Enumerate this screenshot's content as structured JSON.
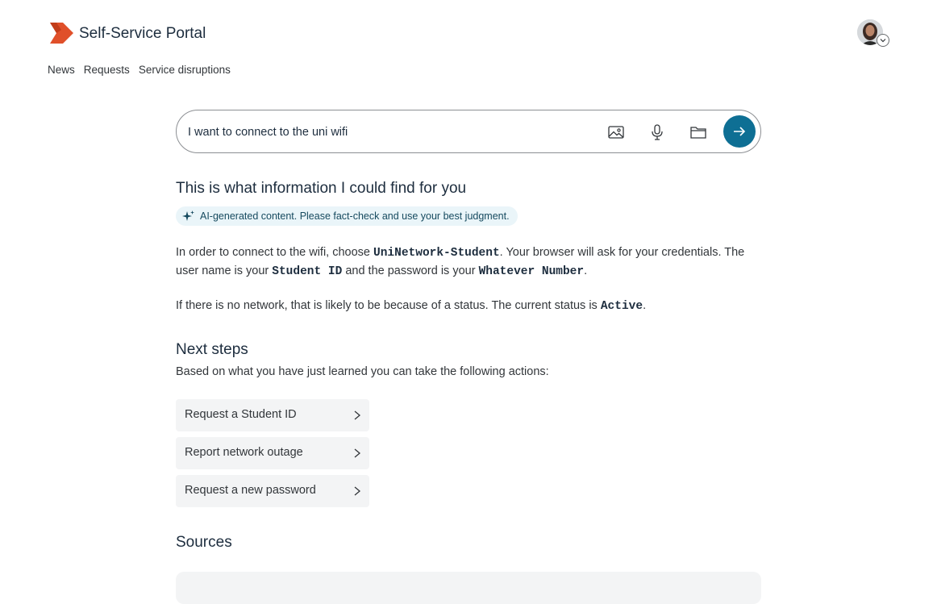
{
  "header": {
    "app_title": "Self-Service Portal",
    "logo_icon": "portal-logo-icon",
    "brand_color": "#e0502a"
  },
  "nav": {
    "items": [
      {
        "label": "News"
      },
      {
        "label": "Requests"
      },
      {
        "label": "Service disruptions"
      }
    ]
  },
  "search": {
    "value": "I want to connect to the uni wifi",
    "placeholder": "",
    "tools": [
      "image-icon",
      "microphone-icon",
      "folder-icon"
    ],
    "send_icon": "arrow-right-icon",
    "accent": "#0e6f94"
  },
  "result": {
    "title": "This is what information I could find for you",
    "ai_notice": "AI-generated content. Please fact-check and use your best judgment.",
    "paragraph1": {
      "t1": "In order to connect to the wifi, choose ",
      "network": "UniNetwork-Student",
      "t2": ". Your browser will ask for your credentials. The user name is your ",
      "user": "Student ID",
      "t3": " and the password is your ",
      "password": "Whatever Number",
      "t4": "."
    },
    "paragraph2": {
      "t1": "If there is no network, that is likely to be because of a status. The current status is ",
      "status": "Active",
      "t2": "."
    }
  },
  "next_steps": {
    "title": "Next steps",
    "subtitle": "Based on what you have just learned you can take the following actions:",
    "actions": [
      {
        "label": "Request a Student ID"
      },
      {
        "label": "Report network outage"
      },
      {
        "label": "Request a new password"
      }
    ]
  },
  "sources": {
    "title": "Sources"
  }
}
